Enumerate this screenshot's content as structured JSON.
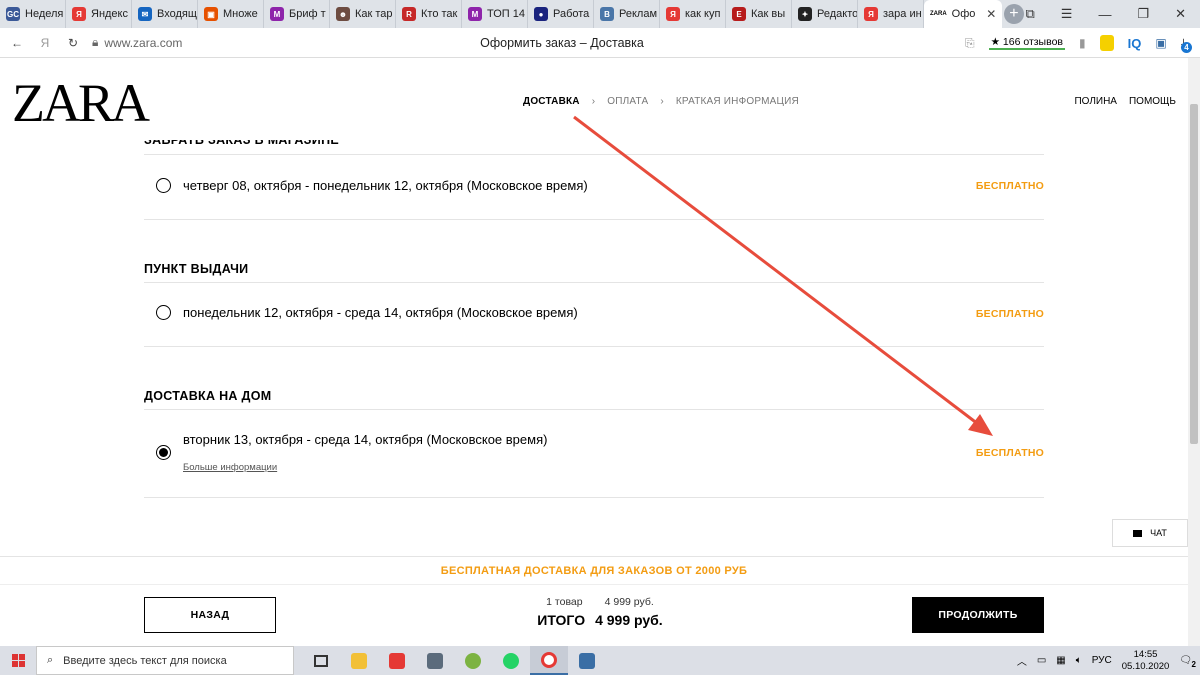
{
  "browser": {
    "tabs": [
      {
        "label": "Неделя",
        "color": "#3b5998",
        "glyph": "GC"
      },
      {
        "label": "Яндекс",
        "color": "#e53935",
        "glyph": "Я"
      },
      {
        "label": "Входящ",
        "color": "#1565c0",
        "glyph": "✉"
      },
      {
        "label": "Множе",
        "color": "#e65100",
        "glyph": "▣"
      },
      {
        "label": "Бриф т",
        "color": "#8e24aa",
        "glyph": "М"
      },
      {
        "label": "Как тар",
        "color": "#6d4c41",
        "glyph": "☻"
      },
      {
        "label": "Кто так",
        "color": "#c62828",
        "glyph": "R"
      },
      {
        "label": "ТОП 14",
        "color": "#8e24aa",
        "glyph": "М"
      },
      {
        "label": "Работа",
        "color": "#1a237e",
        "glyph": "●"
      },
      {
        "label": "Реклам",
        "color": "#4a76a8",
        "glyph": "В"
      },
      {
        "label": "как куп",
        "color": "#e53935",
        "glyph": "Я"
      },
      {
        "label": "Как вы",
        "color": "#b71c1c",
        "glyph": "Е"
      },
      {
        "label": "Редакто",
        "color": "#222222",
        "glyph": "✦"
      },
      {
        "label": "зара ин",
        "color": "#e53935",
        "glyph": "Я"
      }
    ],
    "active_tab": {
      "label": "Офо",
      "glyph": "ZARA"
    },
    "url": "www.zara.com",
    "page_title": "Оформить заказ – Доставка",
    "reviews": "★ 166 отзывов",
    "iq_label": "IQ",
    "download_badge": "4"
  },
  "header": {
    "logo": "ZARA",
    "steps": [
      "ДОСТАВКА",
      "ОПЛАТА",
      "КРАТКАЯ ИНФОРМАЦИЯ"
    ],
    "step_separator": "›",
    "user": "ПОЛИНА",
    "help": "ПОМОЩЬ"
  },
  "sections": {
    "store": {
      "title": "ЗАБРАТЬ ЗАКАЗ В МАГАЗИНЕ",
      "option": "четверг 08, октября - понедельник 12, октября (Московское время)",
      "price": "БЕСПЛАТНО",
      "selected": false
    },
    "pickup": {
      "title": "ПУНКТ ВЫДАЧИ",
      "option": "понедельник 12, октября - среда 14, октября (Московское время)",
      "price": "БЕСПЛАТНО",
      "selected": false
    },
    "home": {
      "title": "ДОСТАВКА НА ДОМ",
      "option": "вторник 13, октября - среда 14, октября (Московское время)",
      "more": "Больше информации",
      "price": "БЕСПЛАТНО",
      "selected": true
    }
  },
  "chat_label": "ЧАТ",
  "footer": {
    "promo": "БЕСПЛАТНАЯ ДОСТАВКА ДЛЯ ЗАКАЗОВ ОТ 2000 РУБ",
    "back": "НАЗАД",
    "items_count": "1 товар",
    "items_price": "4 999 руб.",
    "total_label": "ИТОГО",
    "total_value": "4 999 руб.",
    "continue": "ПРОДОЛЖИТЬ"
  },
  "annotation": {
    "color": "#e74c3c"
  },
  "taskbar": {
    "search_placeholder": "Введите здесь текст для поиска",
    "lang": "РУС",
    "time": "14:55",
    "date": "05.10.2020",
    "notifications": "2"
  }
}
